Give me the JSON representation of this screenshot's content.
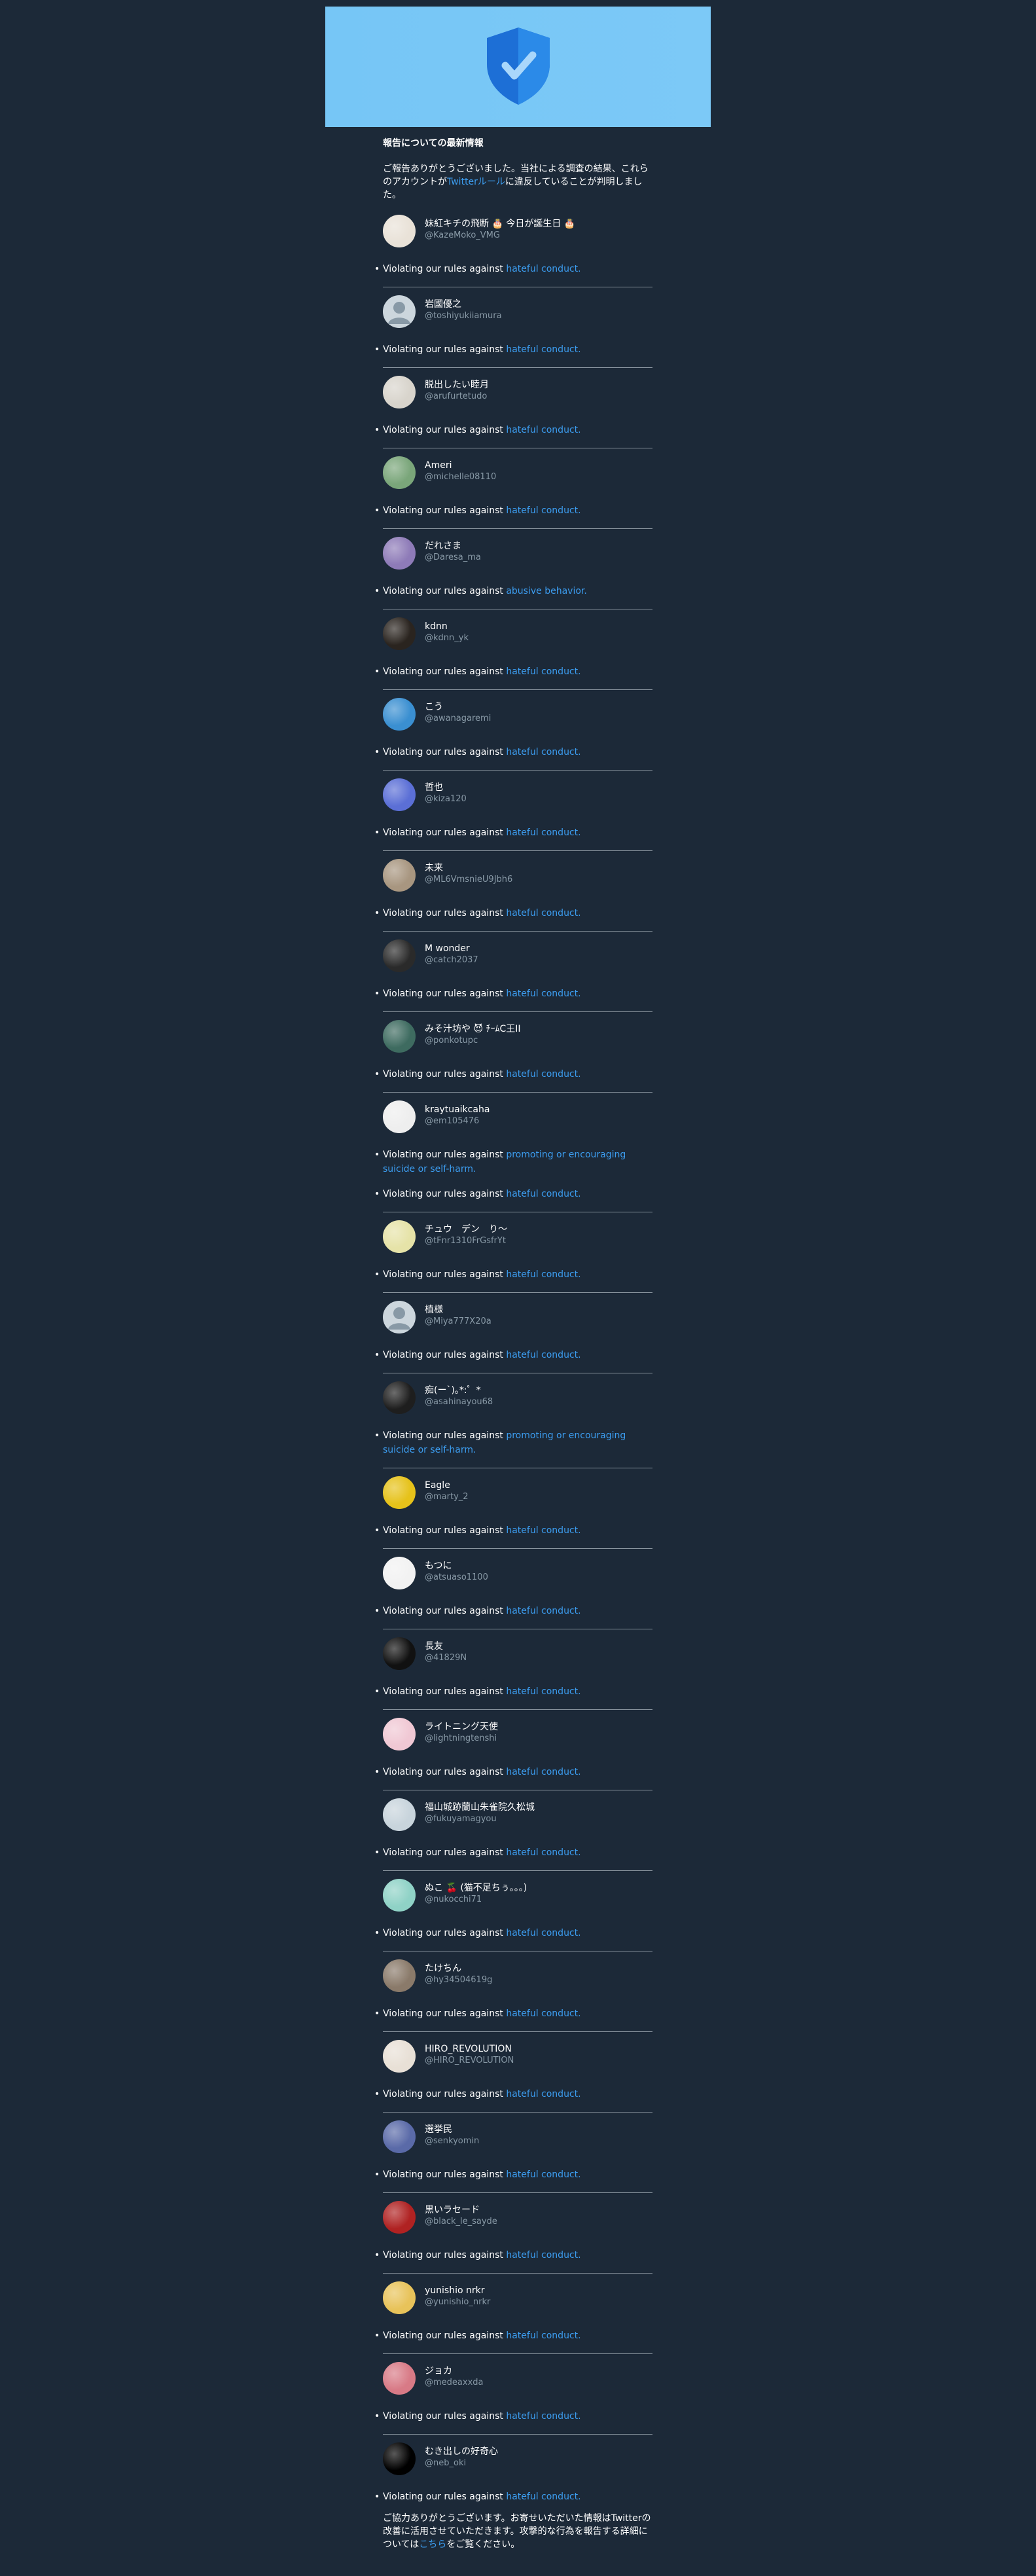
{
  "header": {
    "title": "報告についての最新情報",
    "intro_before": "ご報告ありがとうございました。当社による調査の結果、これらのアカウントが",
    "intro_link": "Twitterルール",
    "intro_after": "に違反していることが判明しました。"
  },
  "violation_prefix": "Violating our rules against ",
  "reports": [
    {
      "name": "妹紅キチの飛断 🎂 今日が誕生日 🎂",
      "handle": "@KazeMoko_VMG",
      "violations": [
        "hateful conduct."
      ],
      "avatar": "#e9e2d8"
    },
    {
      "name": "岩國優之",
      "handle": "@toshiyukiiamura",
      "violations": [
        "hateful conduct."
      ],
      "avatar": "default"
    },
    {
      "name": "脱出したい睦月",
      "handle": "@arufurtetudo",
      "violations": [
        "hateful conduct."
      ],
      "avatar": "#d8d4cc"
    },
    {
      "name": "Ameri",
      "handle": "@michelle08110",
      "violations": [
        "hateful conduct."
      ],
      "avatar": "#7aa67a"
    },
    {
      "name": "だれさま",
      "handle": "@Daresa_ma",
      "violations": [
        "abusive behavior."
      ],
      "avatar": "#8e7bb8"
    },
    {
      "name": "kdnn",
      "handle": "@kdnn_yk",
      "violations": [
        "hateful conduct."
      ],
      "avatar": "#2a241f"
    },
    {
      "name": "こう",
      "handle": "@awanagaremi",
      "violations": [
        "hateful conduct."
      ],
      "avatar": "#3a8fd1"
    },
    {
      "name": "哲也",
      "handle": "@kiza120",
      "violations": [
        "hateful conduct."
      ],
      "avatar": "#5b6fd6"
    },
    {
      "name": "未来",
      "handle": "@ML6VmsnieU9Jbh6",
      "violations": [
        "hateful conduct."
      ],
      "avatar": "#a89680"
    },
    {
      "name": "M wonder",
      "handle": "@catch2037",
      "violations": [
        "hateful conduct."
      ],
      "avatar": "#2a2a2a"
    },
    {
      "name": "みそ汁坊や 😈 ﾁｰﾑC王II",
      "handle": "@ponkotupc",
      "violations": [
        "hateful conduct."
      ],
      "avatar": "#3e6b60"
    },
    {
      "name": "kraytuaikcaha",
      "handle": "@em105476",
      "violations": [
        "promoting or encouraging suicide or self-harm.",
        "hateful conduct."
      ],
      "avatar": "#eeeeee"
    },
    {
      "name": "チュウ　デン　り〜",
      "handle": "@tFnr1310FrGsfrYt",
      "violations": [
        "hateful conduct."
      ],
      "avatar": "#e6e3a8"
    },
    {
      "name": "植様",
      "handle": "@Miya777X20a",
      "violations": [
        "hateful conduct."
      ],
      "avatar": "default"
    },
    {
      "name": "痴(ー`)｡*:゜*",
      "handle": "@asahinayou68",
      "violations": [
        "promoting or encouraging suicide or self-harm."
      ],
      "avatar": "#1e1e1e"
    },
    {
      "name": "Eagle",
      "handle": "@marty_2",
      "violations": [
        "hateful conduct."
      ],
      "avatar": "#e6c21a"
    },
    {
      "name": "もつに",
      "handle": "@atsuaso1100",
      "violations": [
        "hateful conduct."
      ],
      "avatar": "#f2f2f2"
    },
    {
      "name": "長友",
      "handle": "@41829N",
      "violations": [
        "hateful conduct."
      ],
      "avatar": "#111111"
    },
    {
      "name": "ライトニング天使",
      "handle": "@lightningtenshi",
      "violations": [
        "hateful conduct."
      ],
      "avatar": "#f0c8d4"
    },
    {
      "name": "福山城跡蘭山朱雀院久松城",
      "handle": "@fukuyamagyou",
      "violations": [
        "hateful conduct."
      ],
      "avatar": "#c8d4dc"
    },
    {
      "name": "ぬこ 🍒 (猫不足ちぅ。。。)",
      "handle": "@nukocchi71",
      "violations": [
        "hateful conduct."
      ],
      "avatar": "#8fd2c6"
    },
    {
      "name": "たけちん",
      "handle": "@hy34504619g",
      "violations": [
        "hateful conduct."
      ],
      "avatar": "#8a7a6a"
    },
    {
      "name": "HIRO_REVOLUTION",
      "handle": "@HIRO_REVOLUTION",
      "violations": [
        "hateful conduct."
      ],
      "avatar": "#e8e0d6"
    },
    {
      "name": "選挙民",
      "handle": "@senkyomin",
      "violations": [
        "hateful conduct."
      ],
      "avatar": "#5a6aa8"
    },
    {
      "name": "黒いラセード",
      "handle": "@black_le_sayde",
      "violations": [
        "hateful conduct."
      ],
      "avatar": "#b02222"
    },
    {
      "name": "yunishio nrkr",
      "handle": "@yunishio_nrkr",
      "violations": [
        "hateful conduct."
      ],
      "avatar": "#e8c35a"
    },
    {
      "name": "ジョカ",
      "handle": "@medeaxxda",
      "violations": [
        "hateful conduct."
      ],
      "avatar": "#d87a86"
    },
    {
      "name": "むき出しの好奇心",
      "handle": "@neb_oki",
      "violations": [
        "hateful conduct."
      ],
      "avatar": "#000000"
    }
  ],
  "footer": {
    "before": "ご協力ありがとうございます。お寄せいただいた情報はTwitterの改善に活用させていただきます。攻撃的な行為を報告する詳細については",
    "link": "こちら",
    "after": "をご覧ください。"
  },
  "icons": {
    "banner": "shield-check-icon",
    "bullet": "bullet-icon"
  },
  "colors": {
    "background": "#1c2938",
    "banner": "#76c6f6",
    "link": "#3c9df0",
    "handle": "#8899a6",
    "divider": "#8a959f"
  }
}
